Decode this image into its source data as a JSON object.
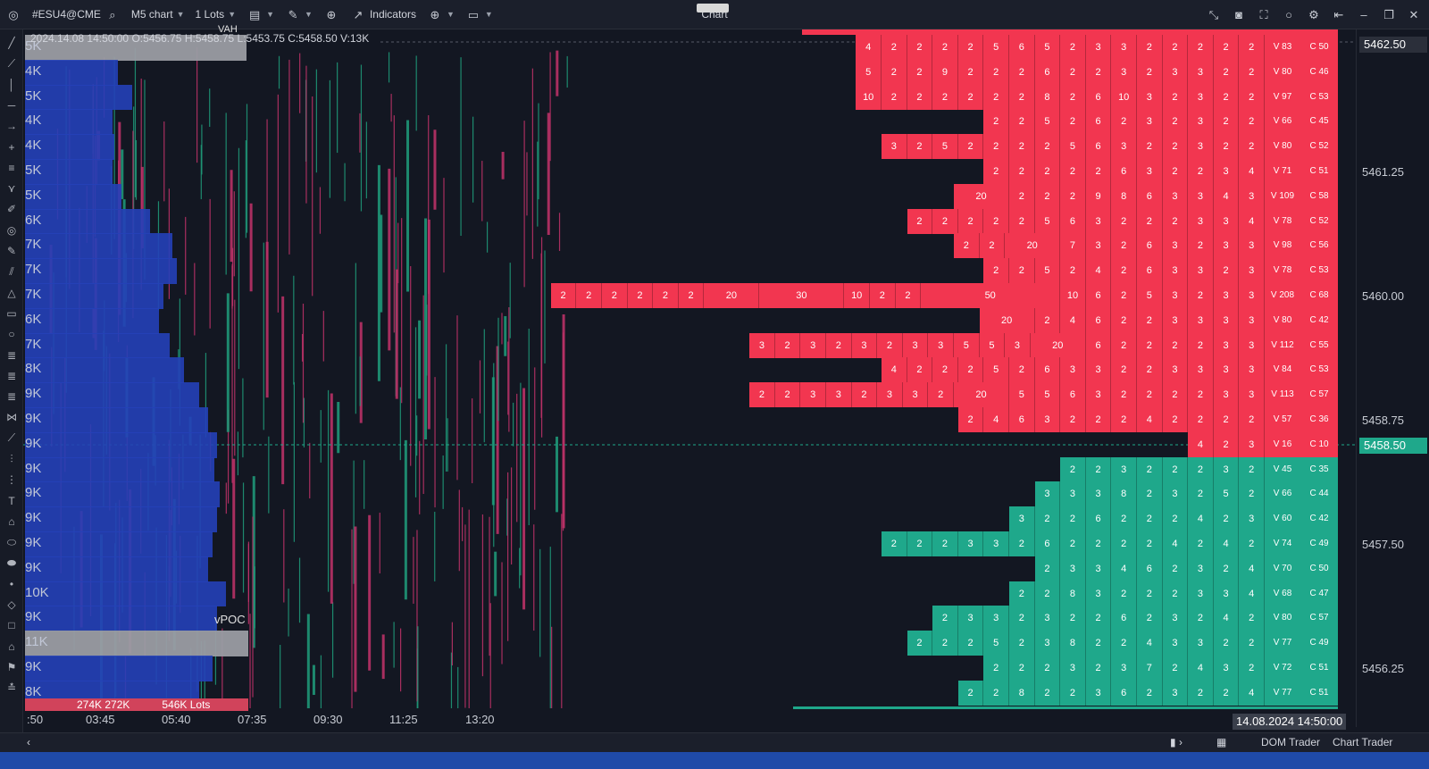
{
  "toolbar": {
    "symbol": "#ESU4@CME",
    "timeframe": "M5 chart",
    "lots": "1 Lots",
    "indicators_label": "Indicators",
    "window_title": "Chart"
  },
  "ohlc_readout": "2024.14.08 14:50:00 O:5456.75 H:5458.75 L:5453.75 C:5458.50 V:13K",
  "price_axis": {
    "labels": [
      "5461.25",
      "5460.00",
      "5458.75",
      "5457.50",
      "5456.25"
    ],
    "top_tag": "5462.50",
    "current_price_tag": "5458.50"
  },
  "time_axis": {
    "labels": [
      ":50",
      "03:45",
      "05:40",
      "07:35",
      "09:30",
      "11:25",
      "13:20"
    ],
    "current_time": "14.08.2024 14:50:00"
  },
  "volume_profile": {
    "labels": [
      "5K",
      "4K",
      "5K",
      "4K",
      "4K",
      "5K",
      "5K",
      "6K",
      "7K",
      "7K",
      "7K",
      "6K",
      "7K",
      "8K",
      "9K",
      "9K",
      "9K",
      "9K",
      "9K",
      "9K",
      "9K",
      "9K",
      "10K",
      "9K",
      "11K",
      "9K",
      "8K"
    ],
    "widths": [
      248,
      104,
      120,
      98,
      100,
      98,
      108,
      140,
      165,
      170,
      155,
      150,
      162,
      178,
      195,
      205,
      215,
      212,
      218,
      215,
      210,
      205,
      225,
      215,
      250,
      210,
      195
    ],
    "vpoc_label": "vPOC",
    "vpoc_index": 24,
    "top_label": "VAH",
    "bottom_text": "274K 272K",
    "bottom_text_right": "546K Lots"
  },
  "footprint": [
    {
      "side": "ask",
      "vals": [
        4,
        2,
        2,
        2,
        2,
        5,
        6,
        5,
        2,
        3,
        3,
        2,
        2,
        2,
        2,
        2
      ],
      "v": "V 83",
      "c": "C 50"
    },
    {
      "side": "ask",
      "vals": [
        5,
        2,
        2,
        9,
        2,
        2,
        2,
        6,
        2,
        2,
        3,
        2,
        3,
        3,
        2,
        2
      ],
      "v": "V 80",
      "c": "C 46"
    },
    {
      "side": "ask",
      "vals": [
        10,
        2,
        2,
        2,
        2,
        2,
        2,
        8,
        2,
        6,
        10,
        3,
        2,
        3,
        2,
        2
      ],
      "v": "V 97",
      "c": "C 53"
    },
    {
      "side": "ask",
      "vals": [
        2,
        2,
        5,
        2,
        6,
        2,
        3,
        2,
        3,
        2,
        2
      ],
      "v": "V 66",
      "c": "C 45"
    },
    {
      "side": "ask",
      "vals": [
        3,
        2,
        5,
        2,
        2,
        2,
        2,
        5,
        6,
        3,
        2,
        2,
        3,
        2,
        2
      ],
      "v": "V 80",
      "c": "C 52"
    },
    {
      "side": "ask",
      "vals": [
        2,
        2,
        2,
        2,
        2,
        6,
        3,
        2,
        2,
        3,
        4
      ],
      "v": "V 71",
      "c": "C 51"
    },
    {
      "side": "ask",
      "vals": [
        20,
        2,
        2,
        2,
        9,
        8,
        6,
        3,
        3,
        4,
        3
      ],
      "v": "V 109",
      "c": "C 58"
    },
    {
      "side": "ask",
      "vals": [
        2,
        2,
        2,
        2,
        2,
        5,
        6,
        3,
        2,
        2,
        2,
        3,
        3,
        4
      ],
      "v": "V 78",
      "c": "C 52"
    },
    {
      "side": "ask",
      "vals": [
        2,
        2,
        20,
        7,
        3,
        2,
        6,
        3,
        2,
        3,
        3
      ],
      "v": "V 98",
      "c": "C 56"
    },
    {
      "side": "ask",
      "vals": [
        2,
        2,
        5,
        2,
        4,
        2,
        6,
        3,
        3,
        2,
        3
      ],
      "v": "V 78",
      "c": "C 53"
    },
    {
      "side": "ask",
      "vals": [
        2,
        2,
        2,
        2,
        2,
        2,
        20,
        30,
        10,
        2,
        2,
        50,
        10,
        6,
        2,
        5,
        3,
        2,
        3,
        3
      ],
      "v": "V 208",
      "c": "C 68"
    },
    {
      "side": "ask",
      "vals": [
        20,
        2,
        4,
        6,
        2,
        2,
        3,
        3,
        3,
        3
      ],
      "v": "V 80",
      "c": "C 42"
    },
    {
      "side": "ask",
      "vals": [
        3,
        2,
        3,
        2,
        3,
        2,
        3,
        3,
        5,
        5,
        3,
        20,
        6,
        2,
        2,
        2,
        2,
        3,
        3
      ],
      "v": "V 112",
      "c": "C 55"
    },
    {
      "side": "ask",
      "vals": [
        4,
        2,
        2,
        2,
        5,
        2,
        6,
        3,
        3,
        2,
        2,
        3,
        3,
        3,
        3
      ],
      "v": "V 84",
      "c": "C 53"
    },
    {
      "side": "ask",
      "vals": [
        2,
        2,
        3,
        3,
        2,
        3,
        3,
        2,
        20,
        5,
        5,
        6,
        3,
        2,
        2,
        2,
        2,
        3,
        3
      ],
      "v": "V 113",
      "c": "C 57"
    },
    {
      "side": "ask",
      "vals": [
        2,
        4,
        6,
        3,
        2,
        2,
        2,
        4,
        2,
        2,
        2,
        2
      ],
      "v": "V 57",
      "c": "C 36"
    },
    {
      "side": "ask",
      "vals": [
        4,
        2,
        3
      ],
      "v": "V 16",
      "c": "C 10"
    },
    {
      "side": "bid",
      "vals": [
        2,
        2,
        3,
        2,
        2,
        2,
        3,
        2
      ],
      "v": "V 45",
      "c": "C 35"
    },
    {
      "side": "bid",
      "vals": [
        3,
        3,
        3,
        8,
        2,
        3,
        2,
        5,
        2
      ],
      "v": "V 66",
      "c": "C 44"
    },
    {
      "side": "bid",
      "vals": [
        3,
        2,
        2,
        6,
        2,
        2,
        2,
        4,
        2,
        3
      ],
      "v": "V 60",
      "c": "C 42"
    },
    {
      "side": "bid",
      "vals": [
        2,
        2,
        2,
        3,
        3,
        2,
        6,
        2,
        2,
        2,
        2,
        4,
        2,
        4,
        2
      ],
      "v": "V 74",
      "c": "C 49"
    },
    {
      "side": "bid",
      "vals": [
        2,
        3,
        3,
        4,
        6,
        2,
        3,
        2,
        4
      ],
      "v": "V 70",
      "c": "C 50"
    },
    {
      "side": "bid",
      "vals": [
        2,
        2,
        8,
        3,
        2,
        2,
        2,
        3,
        3,
        4
      ],
      "v": "V 68",
      "c": "C 47"
    },
    {
      "side": "bid",
      "vals": [
        2,
        3,
        3,
        2,
        3,
        2,
        2,
        6,
        2,
        3,
        2,
        4,
        2
      ],
      "v": "V 80",
      "c": "C 57"
    },
    {
      "side": "bid",
      "vals": [
        2,
        2,
        2,
        5,
        2,
        3,
        8,
        2,
        2,
        4,
        3,
        3,
        2,
        2
      ],
      "v": "V 77",
      "c": "C 49"
    },
    {
      "side": "bid",
      "vals": [
        2,
        2,
        2,
        3,
        2,
        3,
        7,
        2,
        4,
        3,
        2
      ],
      "v": "V 72",
      "c": "C 51"
    },
    {
      "side": "bid",
      "vals": [
        2,
        2,
        8,
        2,
        2,
        3,
        6,
        2,
        3,
        2,
        2,
        4
      ],
      "v": "V 77",
      "c": "C 51"
    }
  ],
  "colors": {
    "ask": "#f23650",
    "bid": "#1fa88b",
    "bg": "#131722",
    "profile": "#2540b8"
  },
  "bottom_bar": {
    "dom_trader": "DOM Trader",
    "chart_trader": "Chart Trader"
  }
}
